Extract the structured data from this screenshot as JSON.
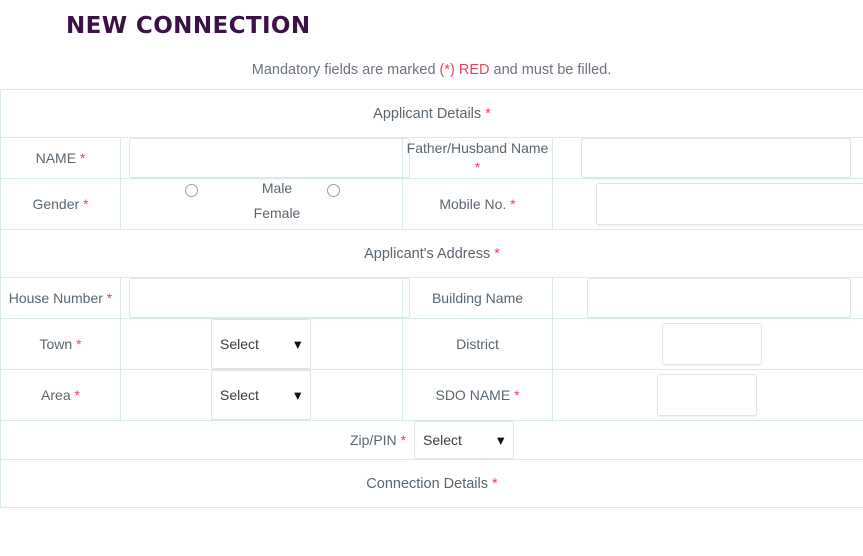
{
  "page": {
    "title": "NEW CONNECTION",
    "mandatory_note": {
      "before": "Mandatory fields are marked ",
      "marker": "(*)",
      "red_word": " RED",
      "after": " and must be filled."
    }
  },
  "sections": {
    "applicant_details": "Applicant Details",
    "applicant_address": "Applicant's Address",
    "connection_details": "Connection Details"
  },
  "fields": {
    "name": {
      "label": "NAME",
      "required": true,
      "value": ""
    },
    "father_husband_name": {
      "label": "Father/Husband Name",
      "required": true,
      "value": ""
    },
    "gender": {
      "label": "Gender",
      "required": true,
      "options": [
        "Male",
        "Female"
      ],
      "selected": ""
    },
    "mobile_no": {
      "label": "Mobile No.",
      "required": true,
      "value": ""
    },
    "house_number": {
      "label": "House Number",
      "required": true,
      "value": ""
    },
    "building_name": {
      "label": "Building Name",
      "required": false,
      "value": ""
    },
    "town": {
      "label": "Town",
      "required": true,
      "selected": "Select",
      "options": [
        "Select"
      ]
    },
    "district": {
      "label": "District",
      "required": false,
      "value": ""
    },
    "area": {
      "label": "Area",
      "required": true,
      "selected": "Select",
      "options": [
        "Select"
      ]
    },
    "sdo_name": {
      "label": "SDO NAME",
      "required": true,
      "value": ""
    },
    "zip_pin": {
      "label": "Zip/PIN",
      "required": true,
      "selected": "Select",
      "options": [
        "Select"
      ]
    }
  },
  "icons": {
    "chevron_down": "⌄"
  },
  "colors": {
    "title": "#3b1146",
    "required": "#e8455f",
    "border": "#d9eaea",
    "text": "#5a6670"
  }
}
